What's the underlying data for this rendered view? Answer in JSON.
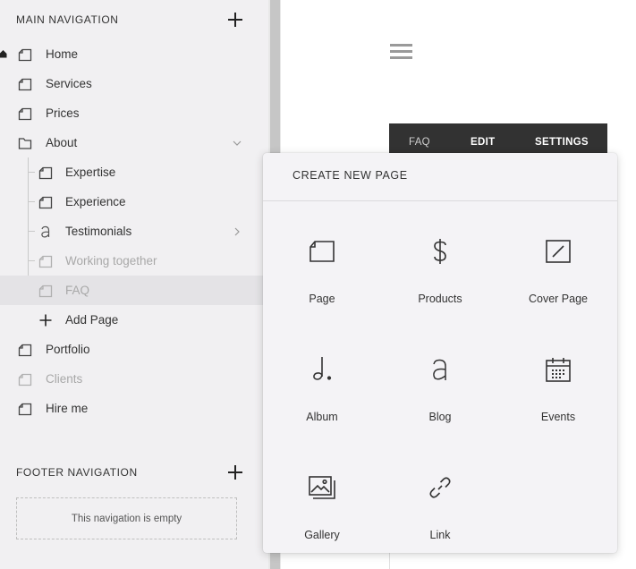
{
  "main_nav": {
    "title": "MAIN NAVIGATION",
    "items": [
      {
        "label": "Home"
      },
      {
        "label": "Services"
      },
      {
        "label": "Prices"
      },
      {
        "label": "About"
      },
      {
        "label": "Expertise"
      },
      {
        "label": "Experience"
      },
      {
        "label": "Testimonials"
      },
      {
        "label": "Working together"
      },
      {
        "label": "FAQ"
      },
      {
        "label": "Add Page"
      },
      {
        "label": "Portfolio"
      },
      {
        "label": "Clients"
      },
      {
        "label": "Hire me"
      }
    ]
  },
  "footer_nav": {
    "title": "FOOTER NAVIGATION",
    "empty_text": "This navigation is empty"
  },
  "top_bar": {
    "faq": "FAQ",
    "edit": "EDIT",
    "settings": "SETTINGS"
  },
  "create_page": {
    "title": "CREATE NEW PAGE",
    "options": [
      {
        "label": "Page",
        "icon": "page-icon"
      },
      {
        "label": "Products",
        "icon": "dollar-icon"
      },
      {
        "label": "Cover Page",
        "icon": "cover-page-icon"
      },
      {
        "label": "Album",
        "icon": "music-note-icon"
      },
      {
        "label": "Blog",
        "icon": "blog-icon"
      },
      {
        "label": "Events",
        "icon": "calendar-icon"
      },
      {
        "label": "Gallery",
        "icon": "gallery-icon"
      },
      {
        "label": "Link",
        "icon": "link-icon"
      }
    ]
  }
}
